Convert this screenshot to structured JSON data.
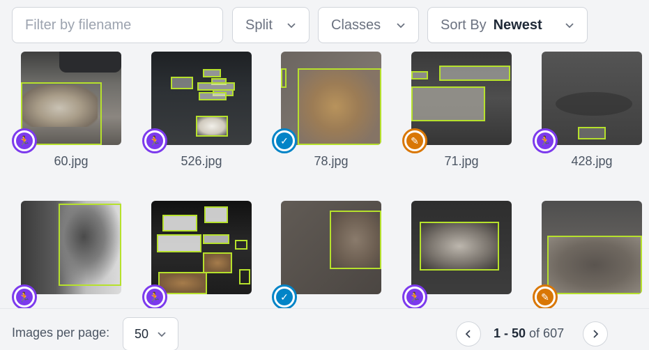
{
  "toolbar": {
    "filter_placeholder": "Filter by filename",
    "split_label": "Split",
    "classes_label": "Classes",
    "sort_label": "Sort By",
    "sort_value": "Newest"
  },
  "images": [
    {
      "filename": "60.jpg",
      "split": "train"
    },
    {
      "filename": "526.jpg",
      "split": "train"
    },
    {
      "filename": "78.jpg",
      "split": "valid"
    },
    {
      "filename": "71.jpg",
      "split": "test"
    },
    {
      "filename": "428.jpg",
      "split": "train"
    },
    {
      "filename": "",
      "split": "train"
    },
    {
      "filename": "",
      "split": "train"
    },
    {
      "filename": "",
      "split": "valid"
    },
    {
      "filename": "",
      "split": "train"
    },
    {
      "filename": "",
      "split": "test"
    }
  ],
  "colors": {
    "annotation": "#b6e12c",
    "train": "#7c3aed",
    "valid": "#0284c7",
    "test": "#d97706"
  },
  "footer": {
    "per_page_label": "Images per page:",
    "per_page_value": "50",
    "range": "1 - 50",
    "of_text": "of 607"
  }
}
